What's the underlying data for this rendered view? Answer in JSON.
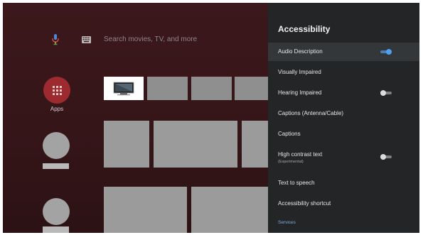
{
  "search": {
    "placeholder_text": "Search movies, TV, and more",
    "mic_icon": "mic-icon",
    "keyboard_icon": "keyboard-icon"
  },
  "apps": {
    "label": "Apps",
    "icon": "apps-grid-icon"
  },
  "colors": {
    "accent": "#4fa0f0",
    "apps_button": "#9c2a2f",
    "panel_bg": "#232527",
    "section_label": "#7ea9e2"
  },
  "panel": {
    "title": "Accessibility",
    "items": [
      {
        "label": "Audio Description",
        "toggle": "on",
        "focused": true
      },
      {
        "label": "Visually Impaired"
      },
      {
        "label": "Hearing Impaired",
        "toggle": "off"
      },
      {
        "label": "Captions (Antenna/Cable)"
      },
      {
        "label": "Captions"
      },
      {
        "label": "High contrast text",
        "sublabel": "(Experimental)",
        "toggle": "off"
      },
      {
        "label": "Text to speech"
      },
      {
        "label": "Accessibility shortcut"
      }
    ],
    "section": "Services"
  }
}
